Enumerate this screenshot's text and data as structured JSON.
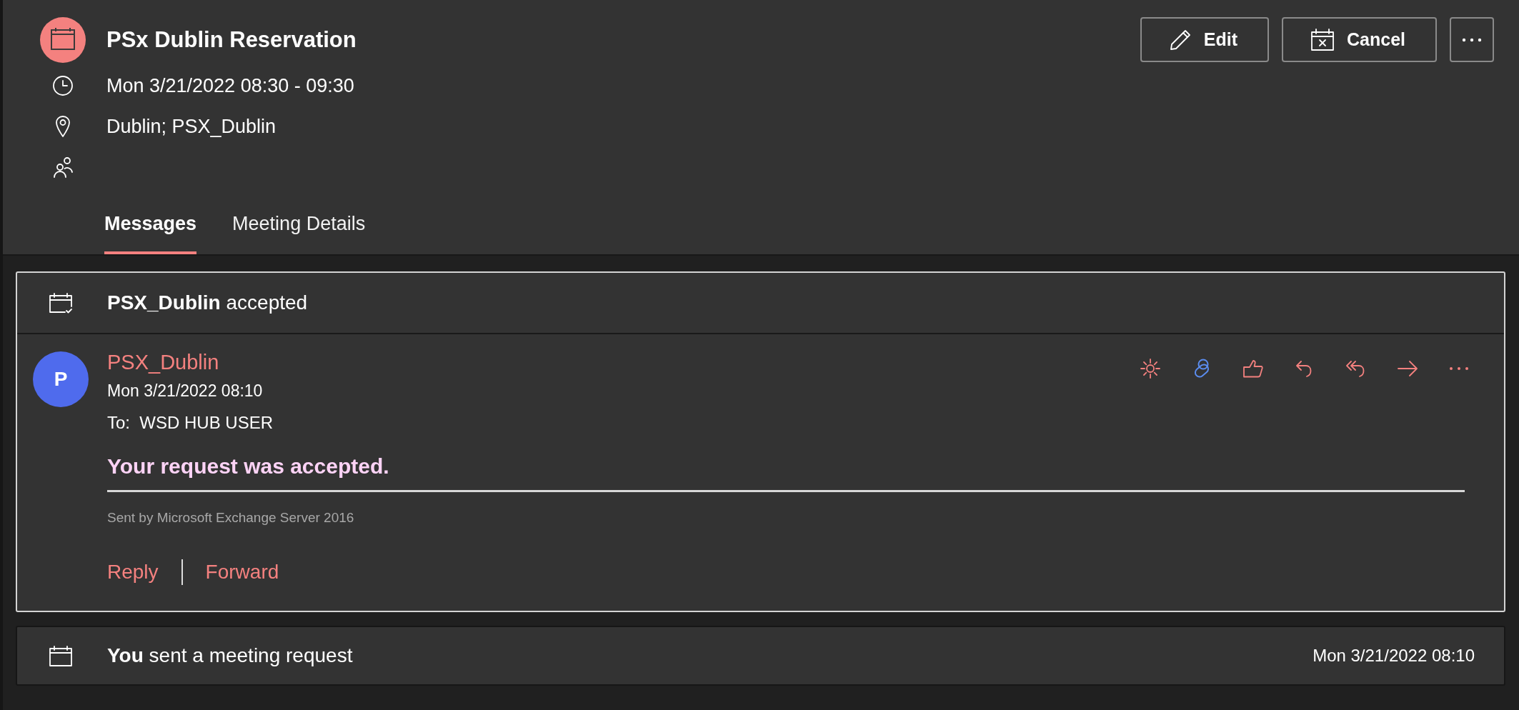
{
  "event": {
    "title": "PSx Dublin Reservation",
    "time": "Mon 3/21/2022 08:30 - 09:30",
    "location": "Dublin; PSX_Dublin"
  },
  "actions": [
    {
      "kind": "edit",
      "label": "Edit"
    },
    {
      "kind": "cancel",
      "label": "Cancel"
    },
    {
      "kind": "more"
    }
  ],
  "tabs": [
    {
      "label": "Messages",
      "selected": true
    },
    {
      "label": "Meeting Details",
      "selected": false
    }
  ],
  "messages": [
    {
      "kind": "accepted",
      "summary": "**PSX_Dublin** accepted",
      "body": {
        "initial": "P",
        "sender": "PSX_Dublin",
        "date": "Mon 3/21/2022 08:10",
        "recipients": "To:  WSD HUB USER",
        "heading": "Your request was accepted.",
        "note": "Sent by Microsoft Exchange Server 2016",
        "links": [
          "Reply",
          "Forward"
        ]
      }
    },
    {
      "kind": "request",
      "summary": "**You** sent a meeting request",
      "date": "Mon 3/21/2022 08:10"
    }
  ]
}
